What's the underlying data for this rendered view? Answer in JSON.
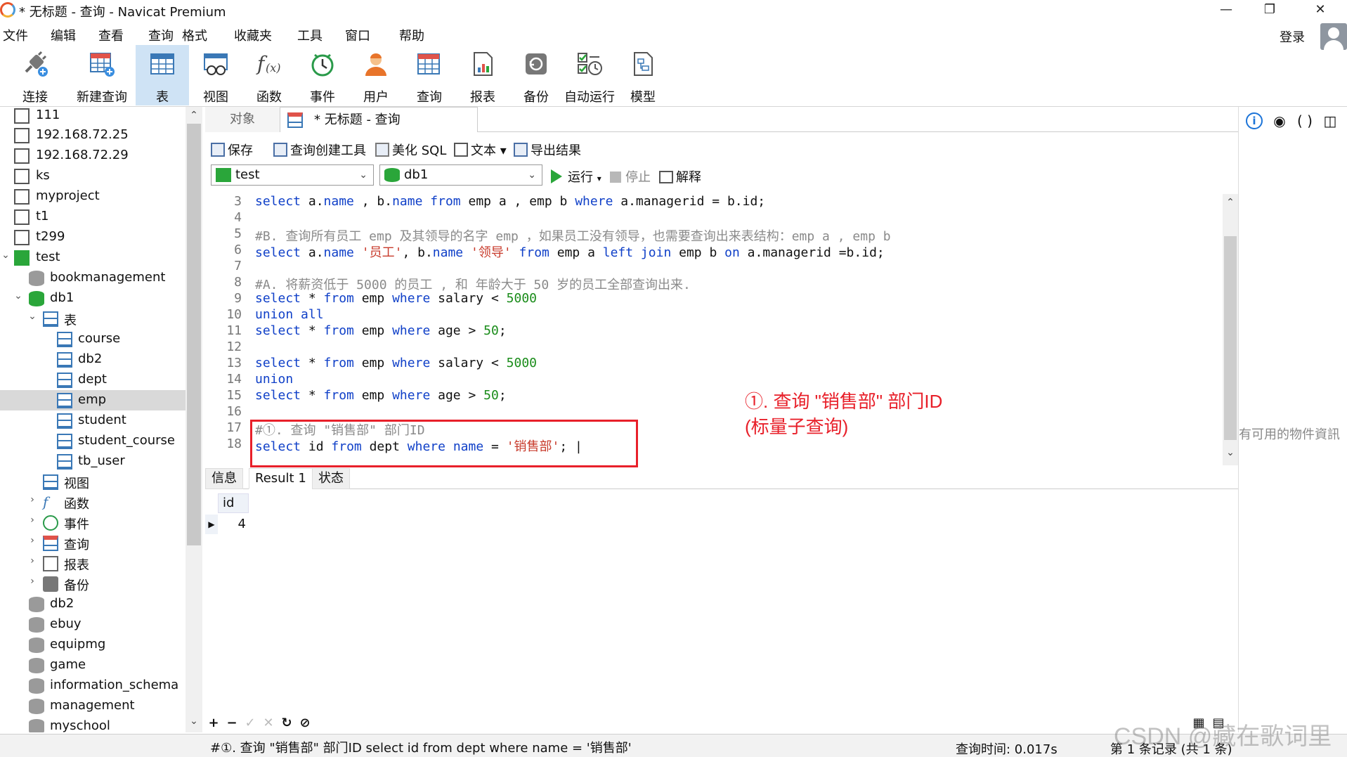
{
  "window": {
    "title": "* 无标题 - 查询 - Navicat Premium",
    "minimize": "—",
    "maximize": "❐",
    "close": "✕"
  },
  "menu": {
    "items": [
      "文件",
      "编辑",
      "查看",
      "查询",
      "格式",
      "收藏夹",
      "工具",
      "窗口",
      "帮助"
    ],
    "login": "登录"
  },
  "toolbar": {
    "items": [
      {
        "label": "连接",
        "icon": "plug-icon"
      },
      {
        "label": "新建查询",
        "icon": "new-query-icon"
      },
      {
        "label": "表",
        "icon": "table-icon",
        "active": true
      },
      {
        "label": "视图",
        "icon": "view-icon"
      },
      {
        "label": "函数",
        "icon": "function-icon"
      },
      {
        "label": "事件",
        "icon": "event-clock-icon"
      },
      {
        "label": "用户",
        "icon": "user-icon"
      },
      {
        "label": "查询",
        "icon": "query-icon"
      },
      {
        "label": "报表",
        "icon": "report-icon"
      },
      {
        "label": "备份",
        "icon": "backup-icon"
      },
      {
        "label": "自动运行",
        "icon": "autorun-icon"
      },
      {
        "label": "模型",
        "icon": "model-icon"
      }
    ]
  },
  "sidebar": {
    "items": [
      {
        "label": "111"
      },
      {
        "label": "192.168.72.25"
      },
      {
        "label": "192.168.72.29"
      },
      {
        "label": "ks"
      },
      {
        "label": "myproject"
      },
      {
        "label": "t1"
      },
      {
        "label": "t299"
      },
      {
        "label": "test"
      },
      {
        "label": "bookmanagement"
      },
      {
        "label": "db1"
      },
      {
        "label": "表"
      },
      {
        "label": "course"
      },
      {
        "label": "db2"
      },
      {
        "label": "dept"
      },
      {
        "label": "emp",
        "selected": true
      },
      {
        "label": "student"
      },
      {
        "label": "student_course"
      },
      {
        "label": "tb_user"
      },
      {
        "label": "视图"
      },
      {
        "label": "函数"
      },
      {
        "label": "事件"
      },
      {
        "label": "查询"
      },
      {
        "label": "报表"
      },
      {
        "label": "备份"
      },
      {
        "label": "db2"
      },
      {
        "label": "ebuy"
      },
      {
        "label": "equipmg"
      },
      {
        "label": "game"
      },
      {
        "label": "information_schema"
      },
      {
        "label": "management"
      },
      {
        "label": "myschool"
      }
    ]
  },
  "tabs": {
    "objects": "对象",
    "query": "* 无标题 - 查询"
  },
  "editor_toolbar": {
    "save": "保存",
    "query_builder": "查询创建工具",
    "beautify": "美化 SQL",
    "text": "文本",
    "export": "导出结果"
  },
  "selectors": {
    "connection": "test",
    "database": "db1",
    "run": "运行",
    "stop": "停止",
    "explain": "解释"
  },
  "code": {
    "line_numbers": [
      "3",
      "4",
      "5",
      "6",
      "7",
      "8",
      "9",
      "10",
      "11",
      "12",
      "13",
      "14",
      "15",
      "16",
      "17",
      "18"
    ]
  },
  "annotation": {
    "line1": "①. 查询 \"销售部\" 部门ID",
    "line2": "(标量子查询)"
  },
  "result_tabs": {
    "info": "信息",
    "result": "Result 1",
    "status": "状态"
  },
  "result": {
    "header": "id",
    "value": "4"
  },
  "right_panel": {
    "empty_text": "有可用的物件資訊"
  },
  "status": {
    "sql": "#①. 查询 \"销售部\" 部门ID select id from dept where name = '销售部'",
    "query_time": "查询时间: 0.017s",
    "records": "第 1 条记录 (共 1 条)"
  },
  "watermark": "CSDN @藏在歌词里",
  "colors": {
    "accent": "#3a78b6",
    "annotation": "#e8202a",
    "keyword": "#1040c8",
    "string": "#c83b2c",
    "number": "#1a8c1a"
  }
}
